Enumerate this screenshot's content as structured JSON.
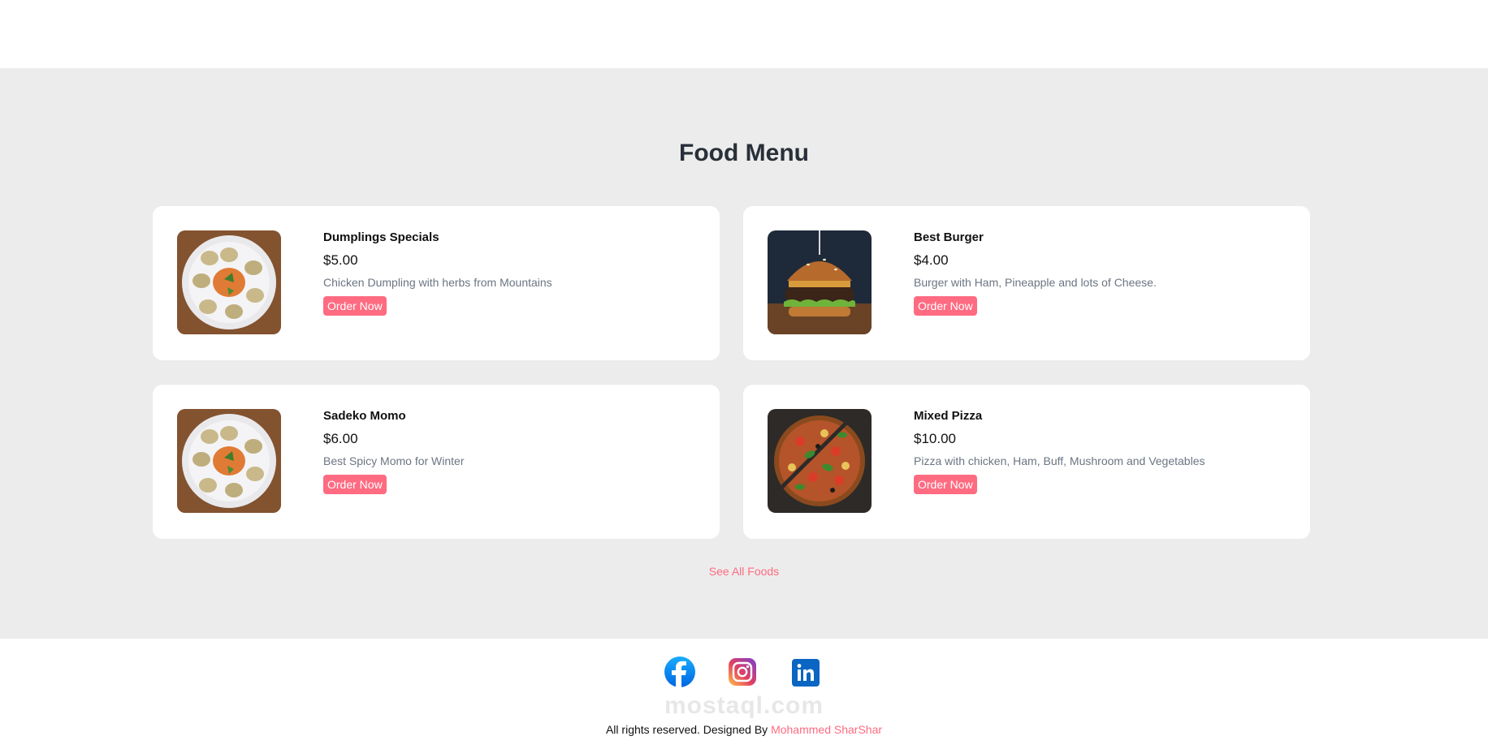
{
  "menu": {
    "title": "Food Menu",
    "see_all_label": "See All Foods",
    "items": [
      {
        "name": "Dumplings Specials",
        "price": "$5.00",
        "description": "Chicken Dumpling with herbs from Mountains",
        "button_label": "Order Now",
        "image": "dumplings-plate"
      },
      {
        "name": "Best Burger",
        "price": "$4.00",
        "description": "Burger with Ham, Pineapple and lots of Cheese.",
        "button_label": "Order Now",
        "image": "burger"
      },
      {
        "name": "Sadeko Momo",
        "price": "$6.00",
        "description": "Best Spicy Momo for Winter",
        "button_label": "Order Now",
        "image": "dumplings-plate"
      },
      {
        "name": "Mixed Pizza",
        "price": "$10.00",
        "description": "Pizza with chicken, Ham, Buff, Mushroom and Vegetables",
        "button_label": "Order Now",
        "image": "pizza"
      }
    ]
  },
  "footer": {
    "social_icons": [
      "facebook-icon",
      "instagram-icon",
      "linkedin-icon"
    ],
    "watermark": "mostaql.com",
    "credit_prefix": "All rights reserved. Designed By",
    "credit_author": "Mohammed SharShar"
  },
  "colors": {
    "accent": "#ff6b81",
    "section_background": "#ececec",
    "title": "#283039",
    "description": "#6b7582"
  }
}
